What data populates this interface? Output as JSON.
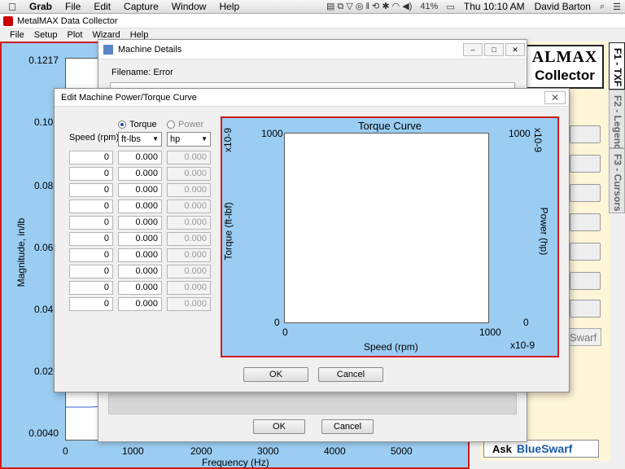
{
  "macbar": {
    "menus": [
      "Grab",
      "File",
      "Edit",
      "Capture",
      "Window",
      "Help"
    ],
    "battery": "41%",
    "clock": "Thu 10:10 AM",
    "user": "David Barton"
  },
  "app": {
    "title": "MetalMAX Data Collector",
    "menus": [
      "File",
      "Setup",
      "Plot",
      "Wizard",
      "Help"
    ]
  },
  "plot": {
    "chart_data": {
      "type": "line",
      "ylabel": "Magnitude, in/lb",
      "xlabel": "Frequency (Hz)",
      "y_ticks": [
        "0.1217",
        "0.102",
        "0.082",
        "0.062",
        "0.043",
        "0.023",
        "0.0040"
      ],
      "x_ticks": [
        "0",
        "1000",
        "2000",
        "3000",
        "4000",
        "5000"
      ],
      "ylim": [
        0.004,
        0.1217
      ],
      "xlim": [
        0,
        5000
      ],
      "series": []
    }
  },
  "logo": {
    "line1": "ALMAX",
    "line2": "Collector"
  },
  "tabs": [
    "F1 - TXF",
    "F2 - Legend",
    "F3 - Cursors"
  ],
  "ask": {
    "prefix": "Ask",
    "brand": "BlueSwarf"
  },
  "swarf_peek": "Swarf",
  "machine_details": {
    "title": "Machine Details",
    "filename": "Filename: Error",
    "ok": "OK",
    "cancel": "Cancel"
  },
  "dialog": {
    "title": "Edit Machine Power/Torque Curve",
    "close": "✕",
    "radio_torque": "Torque",
    "radio_power": "Power",
    "speed_label": "Speed (rpm)",
    "torque_unit": "ft-lbs",
    "power_unit": "hp",
    "rows": [
      [
        "0",
        "0.000",
        "0.000"
      ],
      [
        "0",
        "0.000",
        "0.000"
      ],
      [
        "0",
        "0.000",
        "0.000"
      ],
      [
        "0",
        "0.000",
        "0.000"
      ],
      [
        "0",
        "0.000",
        "0.000"
      ],
      [
        "0",
        "0.000",
        "0.000"
      ],
      [
        "0",
        "0.000",
        "0.000"
      ],
      [
        "0",
        "0.000",
        "0.000"
      ],
      [
        "0",
        "0.000",
        "0.000"
      ],
      [
        "0",
        "0.000",
        "0.000"
      ]
    ],
    "ok": "OK",
    "cancel": "Cancel"
  },
  "torque_chart": {
    "chart_data": {
      "type": "line",
      "title": "Torque Curve",
      "xlabel": "Speed (rpm)",
      "ylabel": "Torque (ft-lbf)",
      "y2label": "Power (hp)",
      "x_ticks": [
        "0",
        "1000"
      ],
      "y_ticks": [
        "0",
        "1000"
      ],
      "y2_ticks": [
        "0",
        "1000"
      ],
      "x_multiplier": "x10-9",
      "y_multiplier": "x10-9",
      "y2_multiplier": "x10-9",
      "series": []
    }
  }
}
